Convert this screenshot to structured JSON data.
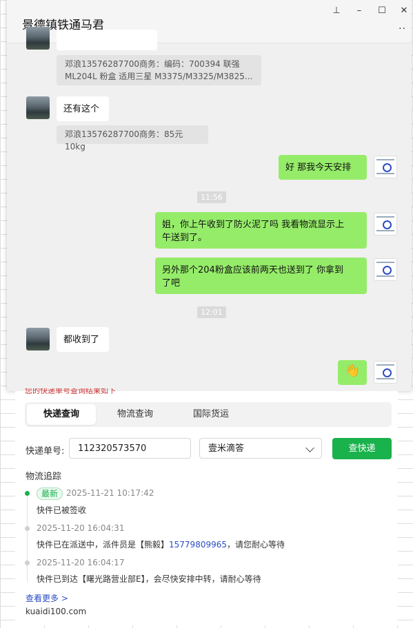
{
  "window": {
    "title": "景德镇铁通马君",
    "controls": {
      "pin": "⊥",
      "minimize": "–",
      "maximize": "☐",
      "close": "✕",
      "more": "··"
    }
  },
  "messages": {
    "quote1_line1": "邓浪13576287700商务：编码：700394 联强",
    "quote1_line2": "ML204L  粉盒 适用三星 M3375/M3325/M3825...",
    "msg_also": "还有这个",
    "quote2": "邓浪13576287700商务：85元  10kg",
    "msg_ok": "好  那我今天安排",
    "time1": "11:56",
    "msg_jie_line1": "姐，你上午收到了防火泥了吗 我看物流显示上",
    "msg_jie_line2": "午送到了。",
    "msg_204_line1": "另外那个204粉盒应该前两天也送到了  你拿到",
    "msg_204_line2": "了吧",
    "time2": "12:01",
    "msg_received": "都收到了",
    "emoji": "👋"
  },
  "kuaidi": {
    "tabs": [
      "快递查询",
      "物流查询",
      "国际货运"
    ],
    "active_tab": "快递查询",
    "number_label": "快递单号:",
    "number_value": "112320573570",
    "carrier_value": "壹米滴答",
    "query_button": "查快递",
    "tracking_title": "物流追踪",
    "events": [
      {
        "badge": "最新",
        "time": "2025-11-21 10:17:42",
        "text": "快件已被签收"
      },
      {
        "time": "2025-11-20 16:04:31",
        "text_before": "快件已在派送中，派件员是【熊毅】",
        "phone": "15779809965",
        "text_after": "，请您耐心等待"
      },
      {
        "time": "2025-11-20 16:04:17",
        "text": "快件已到达【曙光路营业部E】，会尽快安排中转，请耐心等待"
      }
    ],
    "more_link": "查看更多 >",
    "domain": "kuaidi100.com",
    "strip_text": "您的快递单号查询结果如下"
  }
}
